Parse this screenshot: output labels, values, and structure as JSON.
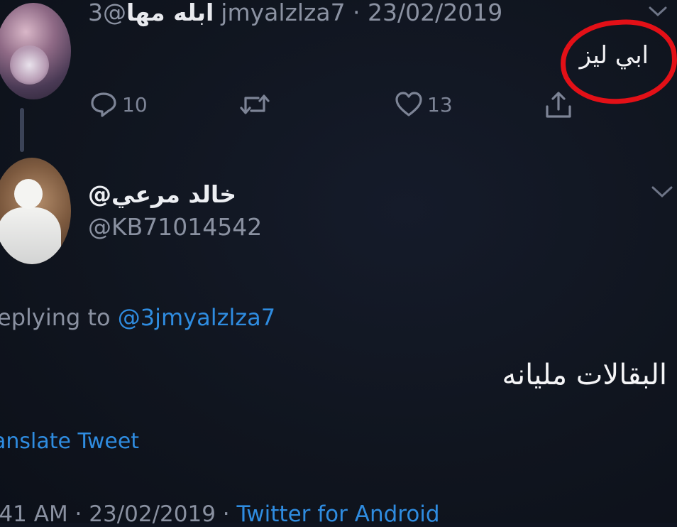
{
  "parent_tweet": {
    "display_name": "ابله مها",
    "handle_and_date": "@3jmyalzlza7 · 23/02/2019",
    "text": "ابي ليز",
    "actions": {
      "reply_count": "10",
      "like_count": "13"
    }
  },
  "reply_tweet": {
    "display_name": "@خالد مرعي",
    "handle": "@KB71014542",
    "replying_prefix": "eplying to",
    "replying_mention": "@3jmyalzlza7",
    "text": "البقالات مليانه",
    "translate_label": "anslate Tweet",
    "meta_time_date": ":41 AM · 23/02/2019 · ",
    "meta_source": "Twitter for Android"
  },
  "colors": {
    "background": "#0f1420",
    "link_blue": "#2f8ce0",
    "highlight_red": "#e31017"
  },
  "icons": [
    "reply-icon",
    "retweet-icon",
    "like-icon",
    "share-icon",
    "chevron-down-icon"
  ]
}
